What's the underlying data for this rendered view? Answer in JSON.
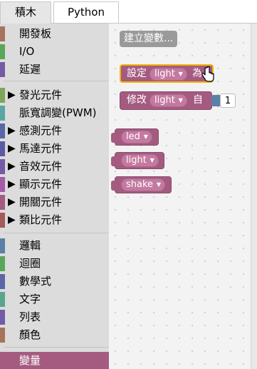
{
  "tabs": [
    {
      "label": "積木",
      "active": true
    },
    {
      "label": "Python",
      "active": false
    }
  ],
  "toolbox": {
    "items": [
      {
        "label": "開發板",
        "color": "#a5745b",
        "arrow": false
      },
      {
        "label": "I/O",
        "color": "#5ba55b",
        "arrow": false
      },
      {
        "label": "延遲",
        "color": "#745ba5",
        "arrow": false
      },
      {
        "label": "發光元件",
        "color": "#80a55b",
        "arrow": true
      },
      {
        "label": "脈寬調變(PWM)",
        "color": "#5ba5a5",
        "arrow": false
      },
      {
        "label": "感測元件",
        "color": "#5b67a5",
        "arrow": true
      },
      {
        "label": "馬達元件",
        "color": "#5b5ba5",
        "arrow": true
      },
      {
        "label": "音效元件",
        "color": "#745ba5",
        "arrow": true
      },
      {
        "label": "顯示元件",
        "color": "#a55ba5",
        "arrow": true
      },
      {
        "label": "開關元件",
        "color": "#a55b80",
        "arrow": true
      },
      {
        "label": "類比元件",
        "color": "#a55b5b",
        "arrow": true
      },
      {
        "label": "邏輯",
        "color": "#5b80a5",
        "arrow": false
      },
      {
        "label": "迴圈",
        "color": "#5ba55b",
        "arrow": false
      },
      {
        "label": "數學式",
        "color": "#5b67a5",
        "arrow": false
      },
      {
        "label": "文字",
        "color": "#5ba58c",
        "arrow": false
      },
      {
        "label": "列表",
        "color": "#745ba5",
        "arrow": false
      },
      {
        "label": "顏色",
        "color": "#a5745b",
        "arrow": false
      },
      {
        "label": "變量",
        "color": "#a55b80",
        "arrow": false,
        "selected": true
      }
    ]
  },
  "flyout": {
    "create_button": "建立變數...",
    "set_block": {
      "prefix": "設定",
      "variable": "light",
      "suffix": "為"
    },
    "change_block": {
      "prefix": "修改",
      "variable": "light",
      "middle": "自",
      "value": "1"
    },
    "variables": [
      "led",
      "light",
      "shake"
    ]
  },
  "colors": {
    "variable_block": "#a55b80",
    "selected_outline": "#f2b40c"
  }
}
